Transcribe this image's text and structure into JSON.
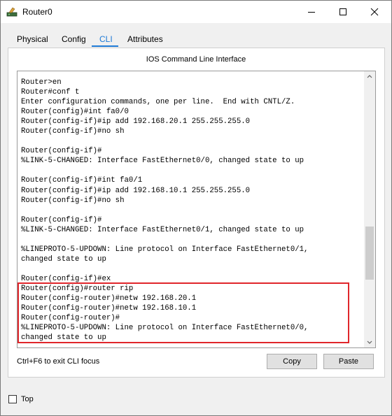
{
  "window": {
    "title": "Router0",
    "controls": {
      "minimize": "minimize",
      "maximize": "maximize",
      "close": "close"
    }
  },
  "tabs": [
    {
      "label": "Physical"
    },
    {
      "label": "Config"
    },
    {
      "label": "CLI",
      "active": true
    },
    {
      "label": "Attributes"
    }
  ],
  "panel": {
    "title": "IOS Command Line Interface"
  },
  "terminal": {
    "lines": [
      "Router>en",
      "Router#conf t",
      "Enter configuration commands, one per line.  End with CNTL/Z.",
      "Router(config)#int fa0/0",
      "Router(config-if)#ip add 192.168.20.1 255.255.255.0",
      "Router(config-if)#no sh",
      "",
      "Router(config-if)#",
      "%LINK-5-CHANGED: Interface FastEthernet0/0, changed state to up",
      "",
      "Router(config-if)#int fa0/1",
      "Router(config-if)#ip add 192.168.10.1 255.255.255.0",
      "Router(config-if)#no sh",
      "",
      "Router(config-if)#",
      "%LINK-5-CHANGED: Interface FastEthernet0/1, changed state to up",
      "",
      "%LINEPROTO-5-UPDOWN: Line protocol on Interface FastEthernet0/1,",
      "changed state to up",
      "",
      "Router(config-if)#ex",
      "Router(config)#router rip",
      "Router(config-router)#netw 192.168.20.1",
      "Router(config-router)#netw 192.168.10.1",
      "Router(config-router)#",
      "%LINEPROTO-5-UPDOWN: Line protocol on Interface FastEthernet0/0,",
      "changed state to up"
    ],
    "highlight_color": "#e0262b"
  },
  "footer": {
    "hint": "Ctrl+F6 to exit CLI focus",
    "copy_label": "Copy",
    "paste_label": "Paste"
  },
  "bottom": {
    "top_label": "Top",
    "top_checked": false
  },
  "colors": {
    "accent": "#1e7ad6",
    "highlight": "#e0262b"
  }
}
